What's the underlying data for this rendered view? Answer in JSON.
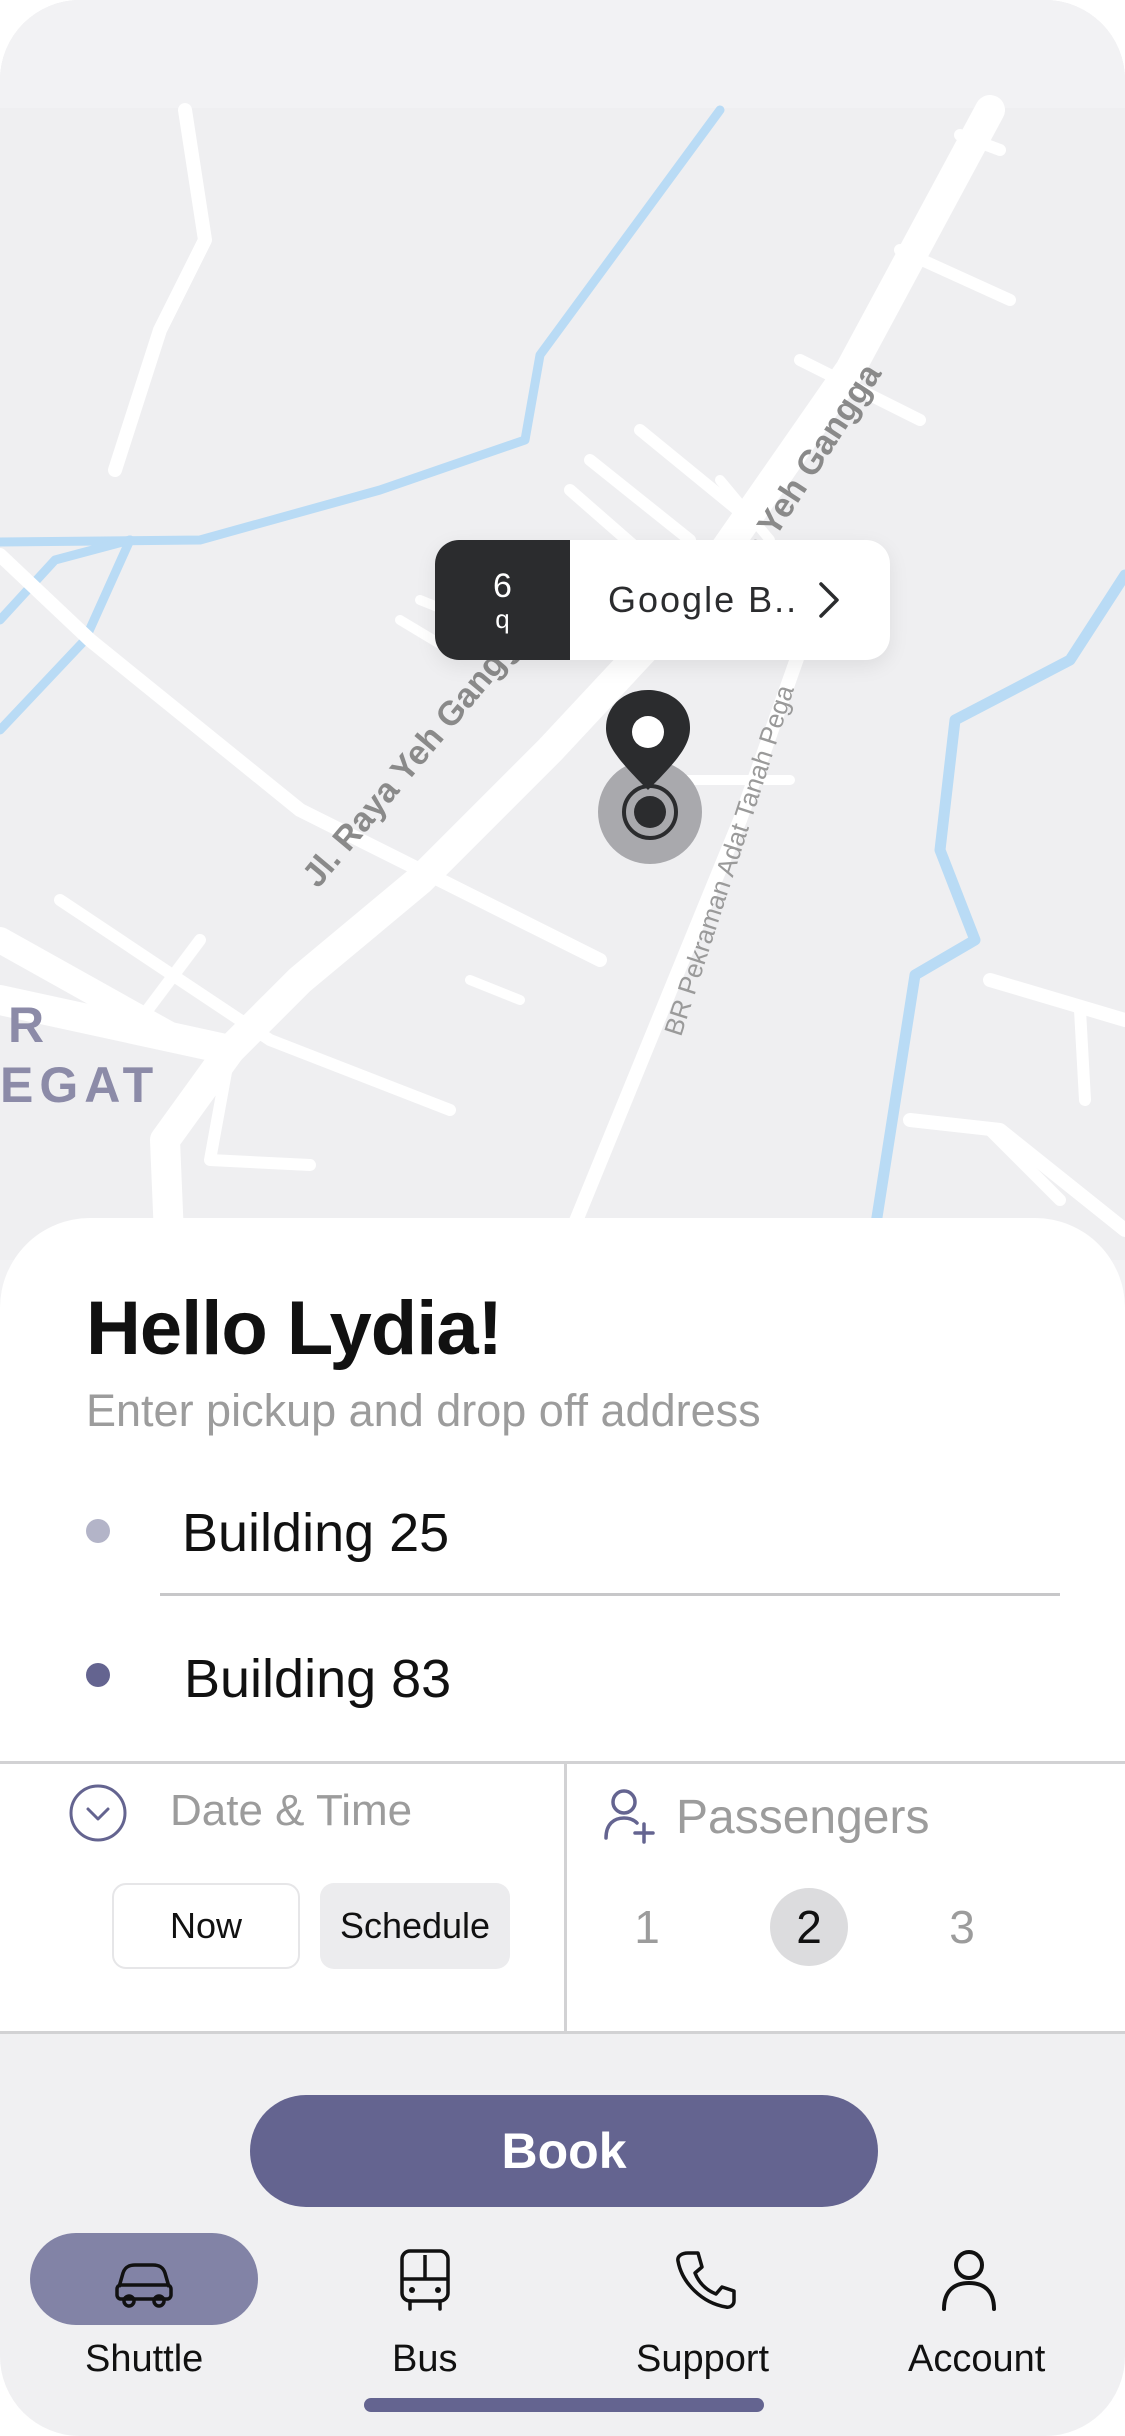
{
  "map": {
    "labels": {
      "road_main_lower": "Jl. Raya Yeh Gangga",
      "road_main_upper": "a Yeh Gangga",
      "road_side": "BR Pekraman Adat Tanah Pega",
      "area_line1": "R",
      "area_line2": "EGAT"
    },
    "callout": {
      "time_value": "6",
      "time_unit": "q",
      "place": "Google B..",
      "chevron_icon": "chevron-right-icon"
    },
    "pin_icon": "location-pin-icon"
  },
  "sheet": {
    "greeting": "Hello Lydia!",
    "subtitle": "Enter pickup and drop off address",
    "pickup": "Building 25",
    "dropoff": "Building 83"
  },
  "datetime": {
    "label": "Date & Time",
    "icon": "chevron-down-circle-icon",
    "now_label": "Now",
    "schedule_label": "Schedule"
  },
  "passengers": {
    "label": "Passengers",
    "icon": "add-person-icon",
    "options": [
      "1",
      "2",
      "3"
    ],
    "selected": "2"
  },
  "book_label": "Book",
  "tabs": [
    {
      "label": "Shuttle",
      "icon": "car-icon",
      "active": true
    },
    {
      "label": "Bus",
      "icon": "bus-icon",
      "active": false
    },
    {
      "label": "Support",
      "icon": "phone-icon",
      "active": false
    },
    {
      "label": "Account",
      "icon": "person-icon",
      "active": false
    }
  ],
  "colors": {
    "accent": "#646490",
    "active_tab": "#8283a6",
    "water": "#b9dbf5",
    "road": "#ffffff",
    "map_bg": "#ececee"
  }
}
